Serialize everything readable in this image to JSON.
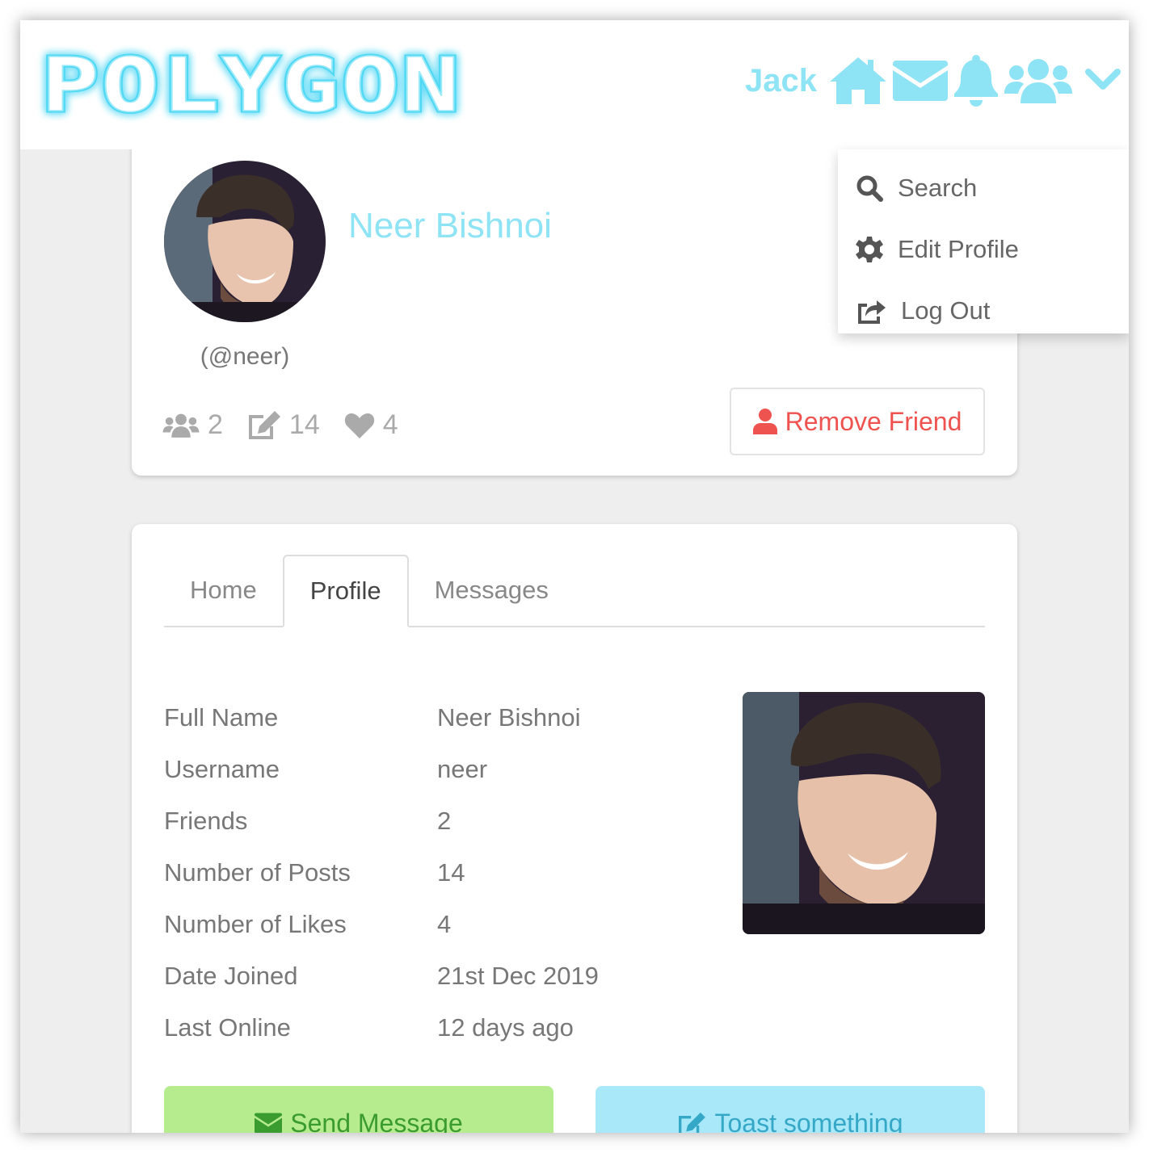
{
  "brand": {
    "logo_text": "POLYGON"
  },
  "navbar": {
    "user_name": "Jack",
    "icons": [
      "home-icon",
      "envelope-icon",
      "bell-icon",
      "users-icon",
      "chevron-down-icon"
    ],
    "accent_color": "#8ee3f5"
  },
  "dropdown": {
    "items": [
      {
        "label": "Search",
        "icon": "search-icon"
      },
      {
        "label": "Edit Profile",
        "icon": "gear-icon"
      },
      {
        "label": "Log Out",
        "icon": "logout-icon"
      }
    ]
  },
  "profile": {
    "name": "Neer Bishnoi",
    "handle": "(@neer)",
    "stats": {
      "friends": "2",
      "posts": "14",
      "likes": "4"
    },
    "remove_friend_label": "Remove Friend"
  },
  "tabs": [
    {
      "label": "Home",
      "active": false
    },
    {
      "label": "Profile",
      "active": true
    },
    {
      "label": "Messages",
      "active": false
    }
  ],
  "details": [
    {
      "label": "Full Name",
      "value": "Neer Bishnoi"
    },
    {
      "label": "Username",
      "value": "neer"
    },
    {
      "label": "Friends",
      "value": "2"
    },
    {
      "label": "Number of Posts",
      "value": "14"
    },
    {
      "label": "Number of Likes",
      "value": "4"
    },
    {
      "label": "Date Joined",
      "value": "21st Dec 2019"
    },
    {
      "label": "Last Online",
      "value": "12 days ago"
    }
  ],
  "actions": {
    "send_message": "Send Message",
    "toast_something": "Toast something"
  },
  "colors": {
    "danger": "#ef5350",
    "success_bg": "#b7ec8e",
    "info_bg": "#a8e8f8"
  }
}
